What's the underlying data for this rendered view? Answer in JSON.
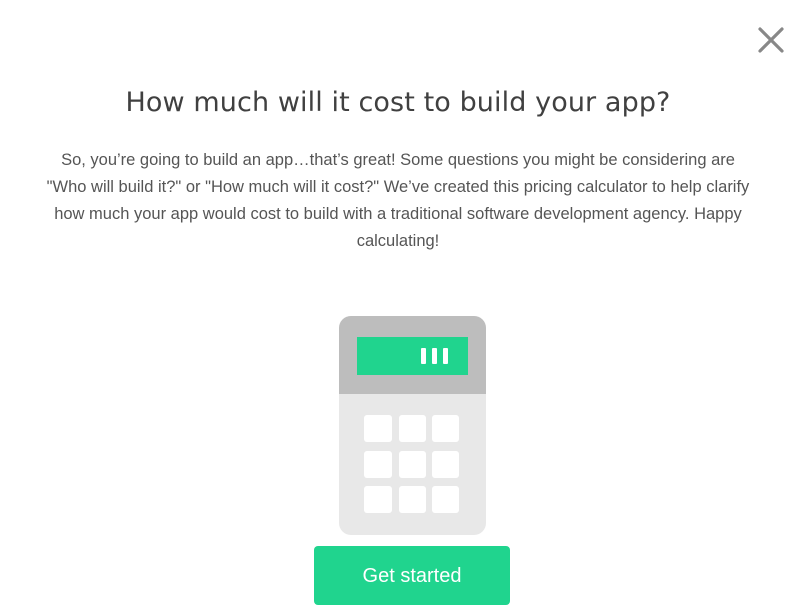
{
  "modal": {
    "title": "How much will it cost to build your app?",
    "description": "So, you’re going to build an app…that’s great! Some questions you might be considering are \"Who will build it?\" or \"How much will it cost?\" We’ve created this pricing calculator to help clarify how much your app would cost to build with a traditional software development agency. Happy calculating!",
    "cta_label": "Get started",
    "close_icon": "close-icon",
    "illustration_icon": "calculator-icon"
  },
  "colors": {
    "accent": "#20d48e",
    "calculator_body": "#e8e8e8",
    "calculator_top": "#bdbdbd",
    "calculator_keys": "#ffffff",
    "close_icon": "#888888",
    "title_text": "#404040",
    "body_text": "#555555"
  }
}
